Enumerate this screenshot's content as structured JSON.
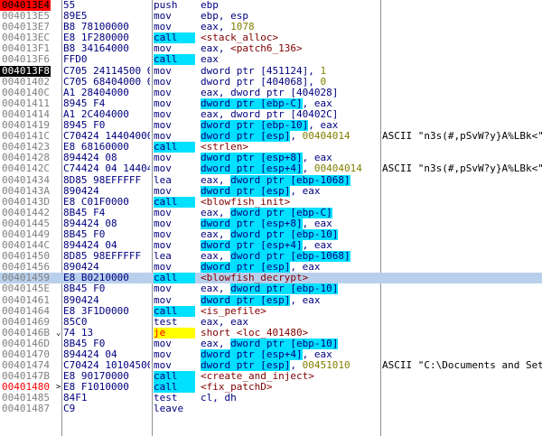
{
  "rows": [
    {
      "addr": "004013E4",
      "hex": "55",
      "mn": "push",
      "op": [
        {
          "t": "ebp"
        }
      ],
      "com": "",
      "addr_style": "bp",
      "mn_style": ""
    },
    {
      "addr": "004013E5",
      "hex": "89E5",
      "mn": "mov",
      "op": [
        {
          "t": "ebp, esp"
        }
      ],
      "com": "",
      "addr_style": "",
      "mn_style": ""
    },
    {
      "addr": "004013E7",
      "hex": "B8 78100000",
      "mn": "mov",
      "op": [
        {
          "t": "eax, "
        },
        {
          "t": "1078",
          "c": "num"
        }
      ],
      "com": "",
      "addr_style": "",
      "mn_style": ""
    },
    {
      "addr": "004013EC",
      "hex": "E8 1F280000",
      "mn": "call",
      "op": [
        {
          "t": "<stack_alloc>",
          "c": "fn"
        }
      ],
      "com": "",
      "addr_style": "",
      "mn_style": "hl"
    },
    {
      "addr": "004013F1",
      "hex": "B8 34164000",
      "mn": "mov",
      "op": [
        {
          "t": "eax, "
        },
        {
          "t": "<patch6_136>",
          "c": "fn"
        }
      ],
      "com": "",
      "addr_style": "",
      "mn_style": ""
    },
    {
      "addr": "004013F6",
      "hex": "FFD0",
      "mn": "call",
      "op": [
        {
          "t": "eax"
        }
      ],
      "com": "",
      "addr_style": "",
      "mn_style": "hl"
    },
    {
      "addr": "004013F8",
      "hex": "C705 24114500 0",
      "mn": "mov",
      "op": [
        {
          "t": "dword ptr [451124], "
        },
        {
          "t": "1",
          "c": "num"
        }
      ],
      "com": "",
      "addr_style": "cur",
      "mn_style": ""
    },
    {
      "addr": "00401402",
      "hex": "C705 68404000 0",
      "mn": "mov",
      "op": [
        {
          "t": "dword ptr [404068], "
        },
        {
          "t": "0",
          "c": "num"
        }
      ],
      "com": "",
      "addr_style": "",
      "mn_style": ""
    },
    {
      "addr": "0040140C",
      "hex": "A1 28404000",
      "mn": "mov",
      "op": [
        {
          "t": "eax, dword ptr [404028]"
        }
      ],
      "com": "",
      "addr_style": "",
      "mn_style": ""
    },
    {
      "addr": "00401411",
      "hex": "8945 F4",
      "mn": "mov",
      "op": [
        {
          "t": "dword ptr [ebp-C]",
          "c": "hl"
        },
        {
          "t": ", eax"
        }
      ],
      "com": "",
      "addr_style": "",
      "mn_style": ""
    },
    {
      "addr": "00401414",
      "hex": "A1 2C404000",
      "mn": "mov",
      "op": [
        {
          "t": "eax, dword ptr [40402C]"
        }
      ],
      "com": "",
      "addr_style": "",
      "mn_style": ""
    },
    {
      "addr": "00401419",
      "hex": "8945 F0",
      "mn": "mov",
      "op": [
        {
          "t": "dword ptr [ebp-10]",
          "c": "hl"
        },
        {
          "t": ", eax"
        }
      ],
      "com": "",
      "addr_style": "",
      "mn_style": ""
    },
    {
      "addr": "0040141C",
      "hex": "C70424 14404000",
      "mn": "mov",
      "op": [
        {
          "t": "dword ptr [esp]",
          "c": "hl"
        },
        {
          "t": ", "
        },
        {
          "t": "00404014",
          "c": "num"
        }
      ],
      "com": "ASCII \"n3s(#,pSvW?y}A%LBk<\"",
      "addr_style": "",
      "mn_style": ""
    },
    {
      "addr": "00401423",
      "hex": "E8 68160000",
      "mn": "call",
      "op": [
        {
          "t": "<strlen>",
          "c": "fn"
        }
      ],
      "com": "",
      "addr_style": "",
      "mn_style": "hl"
    },
    {
      "addr": "00401428",
      "hex": "894424 08",
      "mn": "mov",
      "op": [
        {
          "t": "dword ptr [esp+8]",
          "c": "hl"
        },
        {
          "t": ", eax"
        }
      ],
      "com": "",
      "addr_style": "",
      "mn_style": ""
    },
    {
      "addr": "0040142C",
      "hex": "C74424 04 14404",
      "mn": "mov",
      "op": [
        {
          "t": "dword ptr [esp+4]",
          "c": "hl"
        },
        {
          "t": ", "
        },
        {
          "t": "00404014",
          "c": "num"
        }
      ],
      "com": "ASCII \"n3s(#,pSvW?y}A%LBk<\"",
      "addr_style": "",
      "mn_style": ""
    },
    {
      "addr": "00401434",
      "hex": "8D85 98EFFFFF",
      "mn": "lea",
      "op": [
        {
          "t": "eax, "
        },
        {
          "t": "dword ptr [ebp-1068]",
          "c": "hl"
        }
      ],
      "com": "",
      "addr_style": "",
      "mn_style": ""
    },
    {
      "addr": "0040143A",
      "hex": "890424",
      "mn": "mov",
      "op": [
        {
          "t": "dword ptr [esp]",
          "c": "hl"
        },
        {
          "t": ", eax"
        }
      ],
      "com": "",
      "addr_style": "",
      "mn_style": ""
    },
    {
      "addr": "0040143D",
      "hex": "E8 C01F0000",
      "mn": "call",
      "op": [
        {
          "t": "<blowfish_init>",
          "c": "fn"
        }
      ],
      "com": "",
      "addr_style": "",
      "mn_style": "hl"
    },
    {
      "addr": "00401442",
      "hex": "8B45 F4",
      "mn": "mov",
      "op": [
        {
          "t": "eax, "
        },
        {
          "t": "dword ptr [ebp-C]",
          "c": "hl"
        }
      ],
      "com": "",
      "addr_style": "",
      "mn_style": ""
    },
    {
      "addr": "00401445",
      "hex": "894424 08",
      "mn": "mov",
      "op": [
        {
          "t": "dword ptr [esp+8]",
          "c": "hl"
        },
        {
          "t": ", eax"
        }
      ],
      "com": "",
      "addr_style": "",
      "mn_style": ""
    },
    {
      "addr": "00401449",
      "hex": "8B45 F0",
      "mn": "mov",
      "op": [
        {
          "t": "eax, "
        },
        {
          "t": "dword ptr [ebp-10]",
          "c": "hl"
        }
      ],
      "com": "",
      "addr_style": "",
      "mn_style": ""
    },
    {
      "addr": "0040144C",
      "hex": "894424 04",
      "mn": "mov",
      "op": [
        {
          "t": "dword ptr [esp+4]",
          "c": "hl"
        },
        {
          "t": ", eax"
        }
      ],
      "com": "",
      "addr_style": "",
      "mn_style": ""
    },
    {
      "addr": "00401450",
      "hex": "8D85 98EFFFFF",
      "mn": "lea",
      "op": [
        {
          "t": "eax, "
        },
        {
          "t": "dword ptr [ebp-1068]",
          "c": "hl"
        }
      ],
      "com": "",
      "addr_style": "",
      "mn_style": ""
    },
    {
      "addr": "00401456",
      "hex": "890424",
      "mn": "mov",
      "op": [
        {
          "t": "dword ptr [esp]",
          "c": "hl"
        },
        {
          "t": ", eax"
        }
      ],
      "com": "",
      "addr_style": "",
      "mn_style": ""
    },
    {
      "addr": "00401459",
      "hex": "E8 B0210000",
      "mn": "call",
      "op": [
        {
          "t": "<blowfish_decrypt>",
          "c": "fn"
        }
      ],
      "com": "",
      "addr_style": "",
      "mn_style": "hl",
      "selected": true
    },
    {
      "addr": "0040145E",
      "hex": "8B45 F0",
      "mn": "mov",
      "op": [
        {
          "t": "eax, "
        },
        {
          "t": "dword ptr [ebp-10]",
          "c": "hl"
        }
      ],
      "com": "",
      "addr_style": "",
      "mn_style": ""
    },
    {
      "addr": "00401461",
      "hex": "890424",
      "mn": "mov",
      "op": [
        {
          "t": "dword ptr [esp]",
          "c": "hl"
        },
        {
          "t": ", eax"
        }
      ],
      "com": "",
      "addr_style": "",
      "mn_style": ""
    },
    {
      "addr": "00401464",
      "hex": "E8 3F1D0000",
      "mn": "call",
      "op": [
        {
          "t": "<is_pefile>",
          "c": "fn"
        }
      ],
      "com": "",
      "addr_style": "",
      "mn_style": "hl"
    },
    {
      "addr": "00401469",
      "hex": "85C0",
      "mn": "test",
      "op": [
        {
          "t": "eax, eax"
        }
      ],
      "com": "",
      "addr_style": "",
      "mn_style": ""
    },
    {
      "addr": "0040146B",
      "hex": "74 13",
      "mn": "je",
      "op": [
        {
          "t": "short <loc_401480>",
          "c": "fn"
        }
      ],
      "com": "",
      "addr_style": "",
      "mn_style": "jmp",
      "arrow": "⌄"
    },
    {
      "addr": "0040146D",
      "hex": "8B45 F0",
      "mn": "mov",
      "op": [
        {
          "t": "eax, "
        },
        {
          "t": "dword ptr [ebp-10]",
          "c": "hl"
        }
      ],
      "com": "",
      "addr_style": "",
      "mn_style": ""
    },
    {
      "addr": "00401470",
      "hex": "894424 04",
      "mn": "mov",
      "op": [
        {
          "t": "dword ptr [esp+4]",
          "c": "hl"
        },
        {
          "t": ", eax"
        }
      ],
      "com": "",
      "addr_style": "",
      "mn_style": ""
    },
    {
      "addr": "00401474",
      "hex": "C70424 10104500",
      "mn": "mov",
      "op": [
        {
          "t": "dword ptr [esp]",
          "c": "hl"
        },
        {
          "t": ", "
        },
        {
          "t": "00451010",
          "c": "num"
        }
      ],
      "com": "ASCII \"C:\\Documents and Sett",
      "addr_style": "",
      "mn_style": ""
    },
    {
      "addr": "0040147B",
      "hex": "E8 90170000",
      "mn": "call",
      "op": [
        {
          "t": "<create_and_inject>",
          "c": "fn"
        }
      ],
      "com": "",
      "addr_style": "",
      "mn_style": "hl"
    },
    {
      "addr": "00401480",
      "hex": "E8 F1010000",
      "mn": "call",
      "op": [
        {
          "t": "<fix_patchD>",
          "c": "fn"
        }
      ],
      "com": "",
      "addr_style": "bpred",
      "mn_style": "hl",
      "arrow": ">"
    },
    {
      "addr": "00401485",
      "hex": "84F1",
      "mn": "test",
      "op": [
        {
          "t": "cl, dh"
        }
      ],
      "com": "",
      "addr_style": "",
      "mn_style": ""
    },
    {
      "addr": "00401487",
      "hex": "C9",
      "mn": "leave",
      "op": [
        {
          "t": ""
        }
      ],
      "com": "",
      "addr_style": "",
      "mn_style": ""
    }
  ],
  "colors": {
    "breakpoint": "#ff0000",
    "call_highlight": "#00e0ff",
    "jump_highlight": "#ffff00",
    "selection": "#b8d0ec"
  }
}
